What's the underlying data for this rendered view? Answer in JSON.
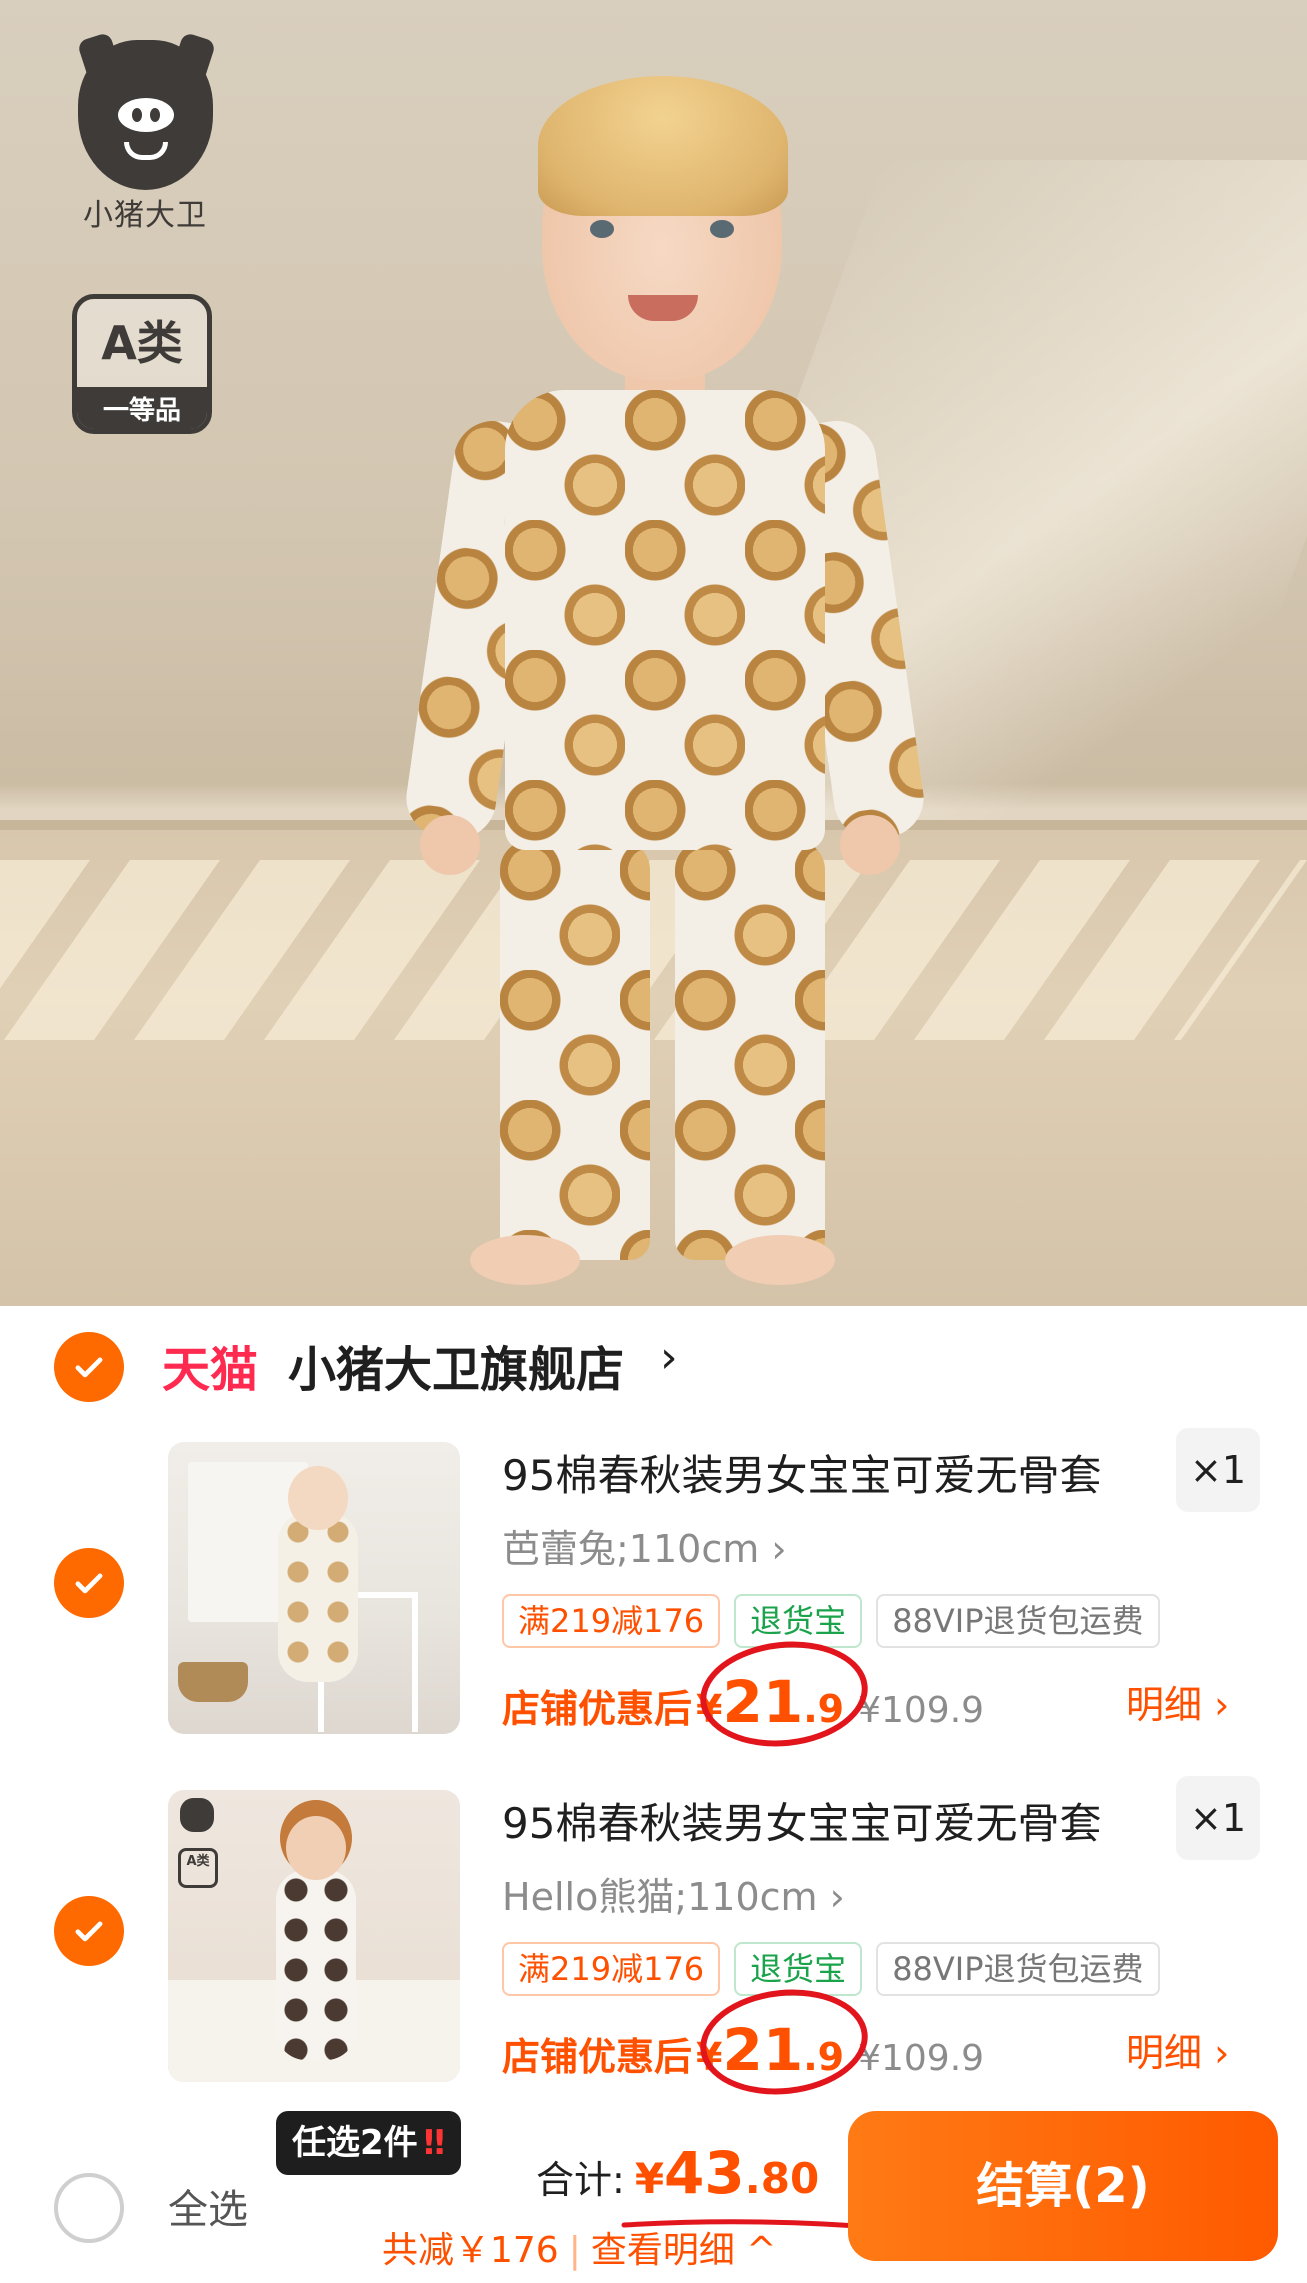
{
  "hero": {
    "brand_logo_text": "小猪大卫",
    "grade_badge": {
      "top": "A类",
      "bottom": "一等品"
    }
  },
  "store": {
    "platform": "天猫",
    "name": "小猪大卫旗舰店",
    "chevron": "›"
  },
  "items": [
    {
      "title": "95棉春秋装男女宝宝可爱无骨套",
      "quantity": "×1",
      "sku": "芭蕾兔;110cm ›",
      "tags": [
        "满219减176",
        "退货宝",
        "88VIP退货包运费"
      ],
      "price_label": "店铺优惠后",
      "currency": "¥",
      "price_int": "21",
      "price_dec": ".9",
      "original_price": "¥109.9",
      "detail_link": "明细 ›"
    },
    {
      "title": "95棉春秋装男女宝宝可爱无骨套",
      "quantity": "×1",
      "sku": "Hello熊猫;110cm ›",
      "tags": [
        "满219减176",
        "退货宝",
        "88VIP退货包运费"
      ],
      "price_label": "店铺优惠后",
      "currency": "¥",
      "price_int": "21",
      "price_dec": ".9",
      "original_price": "¥109.9",
      "detail_link": "明细 ›"
    }
  ],
  "bottom_bar": {
    "select_all": "全选",
    "promo_chip": "任选2件",
    "promo_chip_mark": "‼",
    "total_label": "合计:",
    "total_currency": "¥",
    "total_int": "43",
    "total_dec": ".80",
    "savings": "共减￥176",
    "savings_sep": "|",
    "savings_detail": "查看明细 ^",
    "checkout": "结算(2)"
  },
  "colors": {
    "accent": "#ff5000",
    "check": "#ff6a00",
    "tmall": "#ff2a4f",
    "annotation": "#e3151c"
  },
  "icons": [
    "check-icon",
    "chevron-right-icon",
    "chevron-up-icon",
    "pig-logo-icon"
  ]
}
